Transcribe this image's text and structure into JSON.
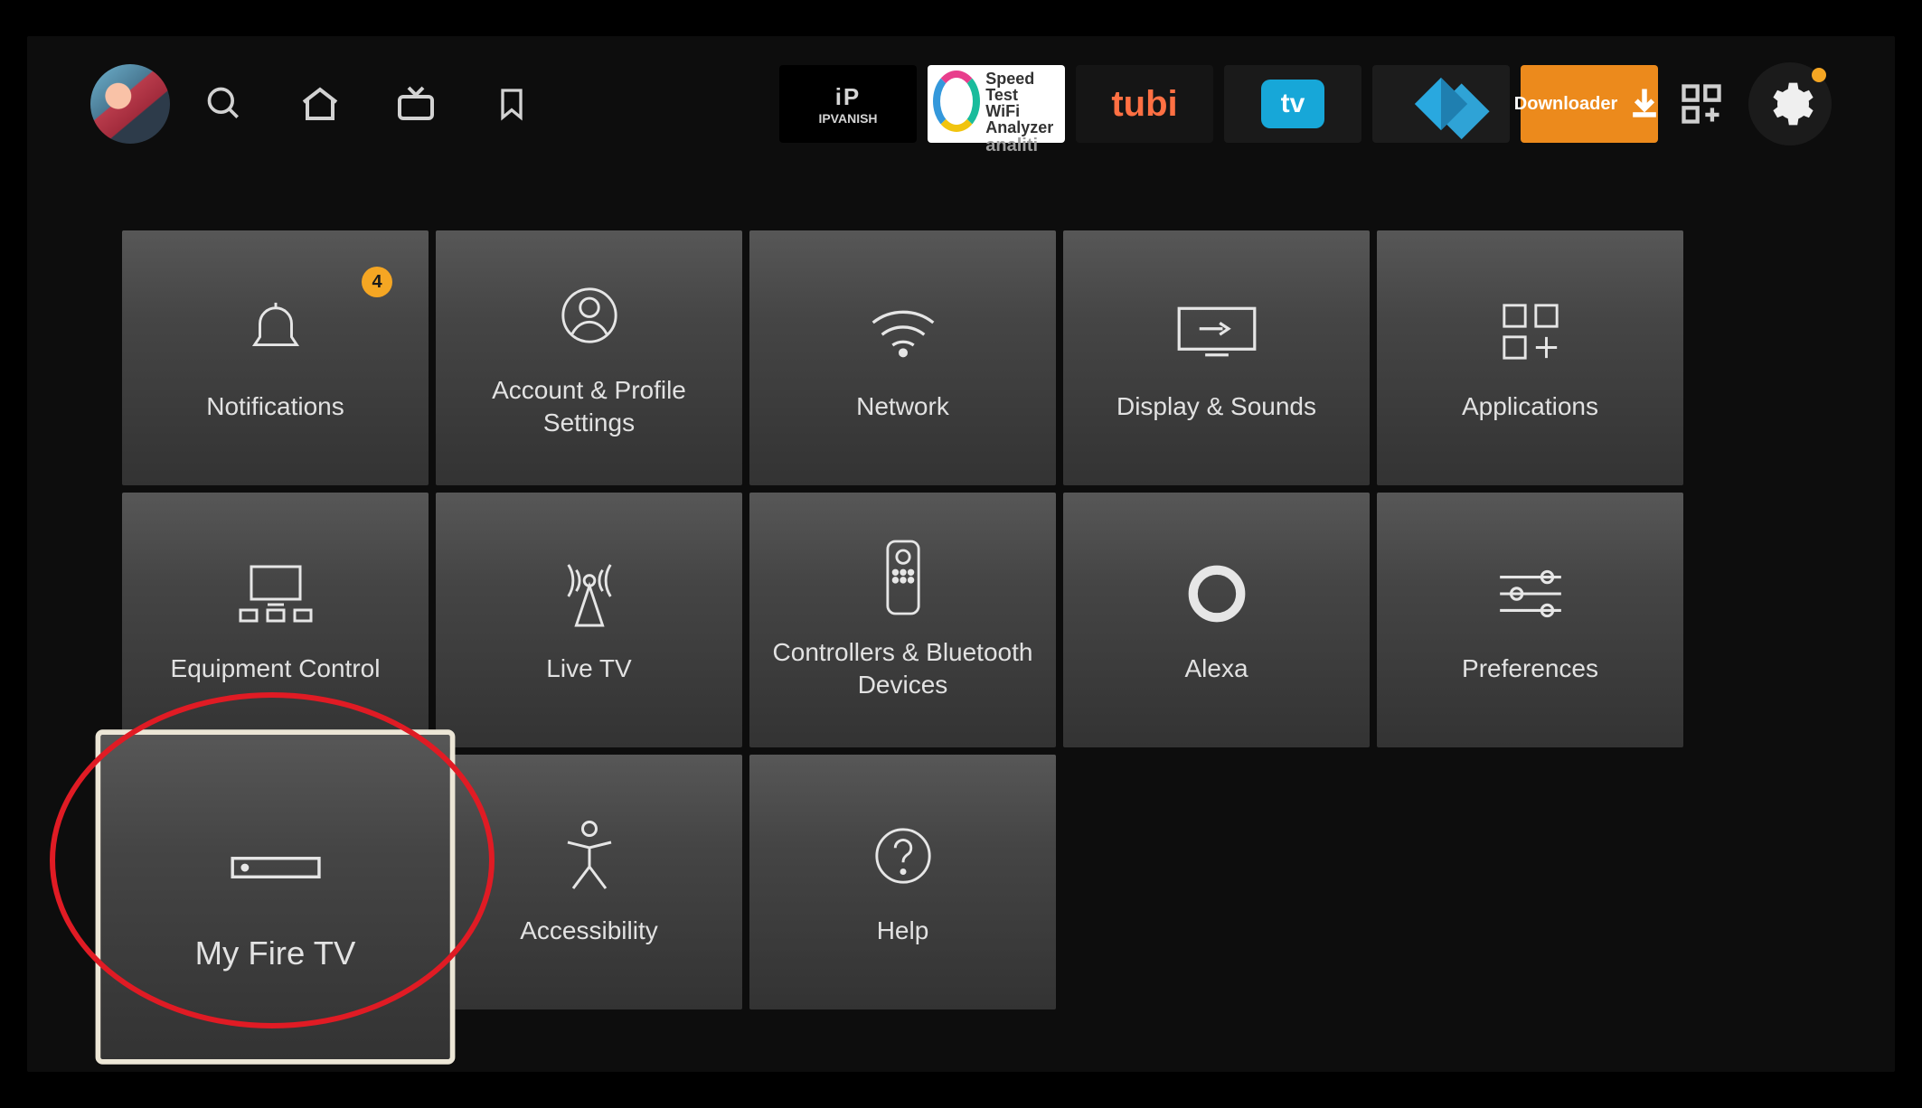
{
  "topbar": {
    "apps": [
      {
        "id": "ipvanish",
        "label_top": "iP",
        "label_bottom": "IPVANISH"
      },
      {
        "id": "analiti",
        "line1": "Speed Test",
        "line2": "WiFi Analyzer",
        "brand": "analiti"
      },
      {
        "id": "tubi",
        "label": "tubi"
      },
      {
        "id": "tivimate",
        "label": "tv"
      },
      {
        "id": "kodi",
        "label": ""
      },
      {
        "id": "downloader",
        "label": "Downloader"
      }
    ]
  },
  "settings": {
    "tiles": [
      {
        "id": "notifications",
        "label": "Notifications",
        "badge": "4"
      },
      {
        "id": "account",
        "label": "Account & Profile Settings"
      },
      {
        "id": "network",
        "label": "Network"
      },
      {
        "id": "display",
        "label": "Display & Sounds"
      },
      {
        "id": "applications",
        "label": "Applications"
      },
      {
        "id": "equipment",
        "label": "Equipment Control"
      },
      {
        "id": "livetv",
        "label": "Live TV"
      },
      {
        "id": "controllers",
        "label": "Controllers & Bluetooth Devices"
      },
      {
        "id": "alexa",
        "label": "Alexa"
      },
      {
        "id": "preferences",
        "label": "Preferences"
      },
      {
        "id": "myfiretv",
        "label": "My Fire TV",
        "selected": true
      },
      {
        "id": "accessibility",
        "label": "Accessibility"
      },
      {
        "id": "help",
        "label": "Help"
      }
    ]
  }
}
